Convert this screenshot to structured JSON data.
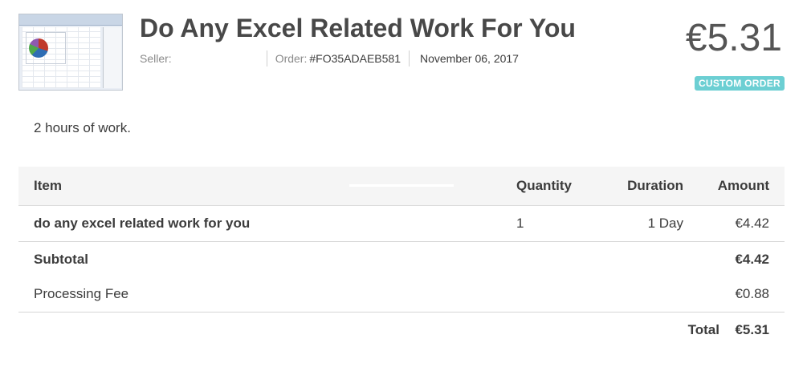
{
  "order": {
    "title": "Do Any Excel Related Work For You",
    "seller_label": "Seller:",
    "order_label": "Order:",
    "order_id": "#FO35ADAEB581",
    "date": "November 06, 2017",
    "price": "€5.31",
    "badge": "CUSTOM ORDER",
    "description": "2 hours of work."
  },
  "table": {
    "headers": {
      "item": "Item",
      "quantity": "Quantity",
      "duration": "Duration",
      "amount": "Amount"
    },
    "rows": [
      {
        "item": "do any excel related work for you",
        "quantity": "1",
        "duration": "1 Day",
        "amount": "€4.42"
      }
    ],
    "subtotal_label": "Subtotal",
    "subtotal_value": "€4.42",
    "fee_label": "Processing Fee",
    "fee_value": "€0.88",
    "total_label": "Total",
    "total_value": "€5.31"
  },
  "colors": {
    "badge": "#6ccfd3",
    "header_bg": "#f5f5f5",
    "title": "#484848"
  },
  "icons": {
    "thumbnail": "excel-spreadsheet-thumbnail"
  }
}
